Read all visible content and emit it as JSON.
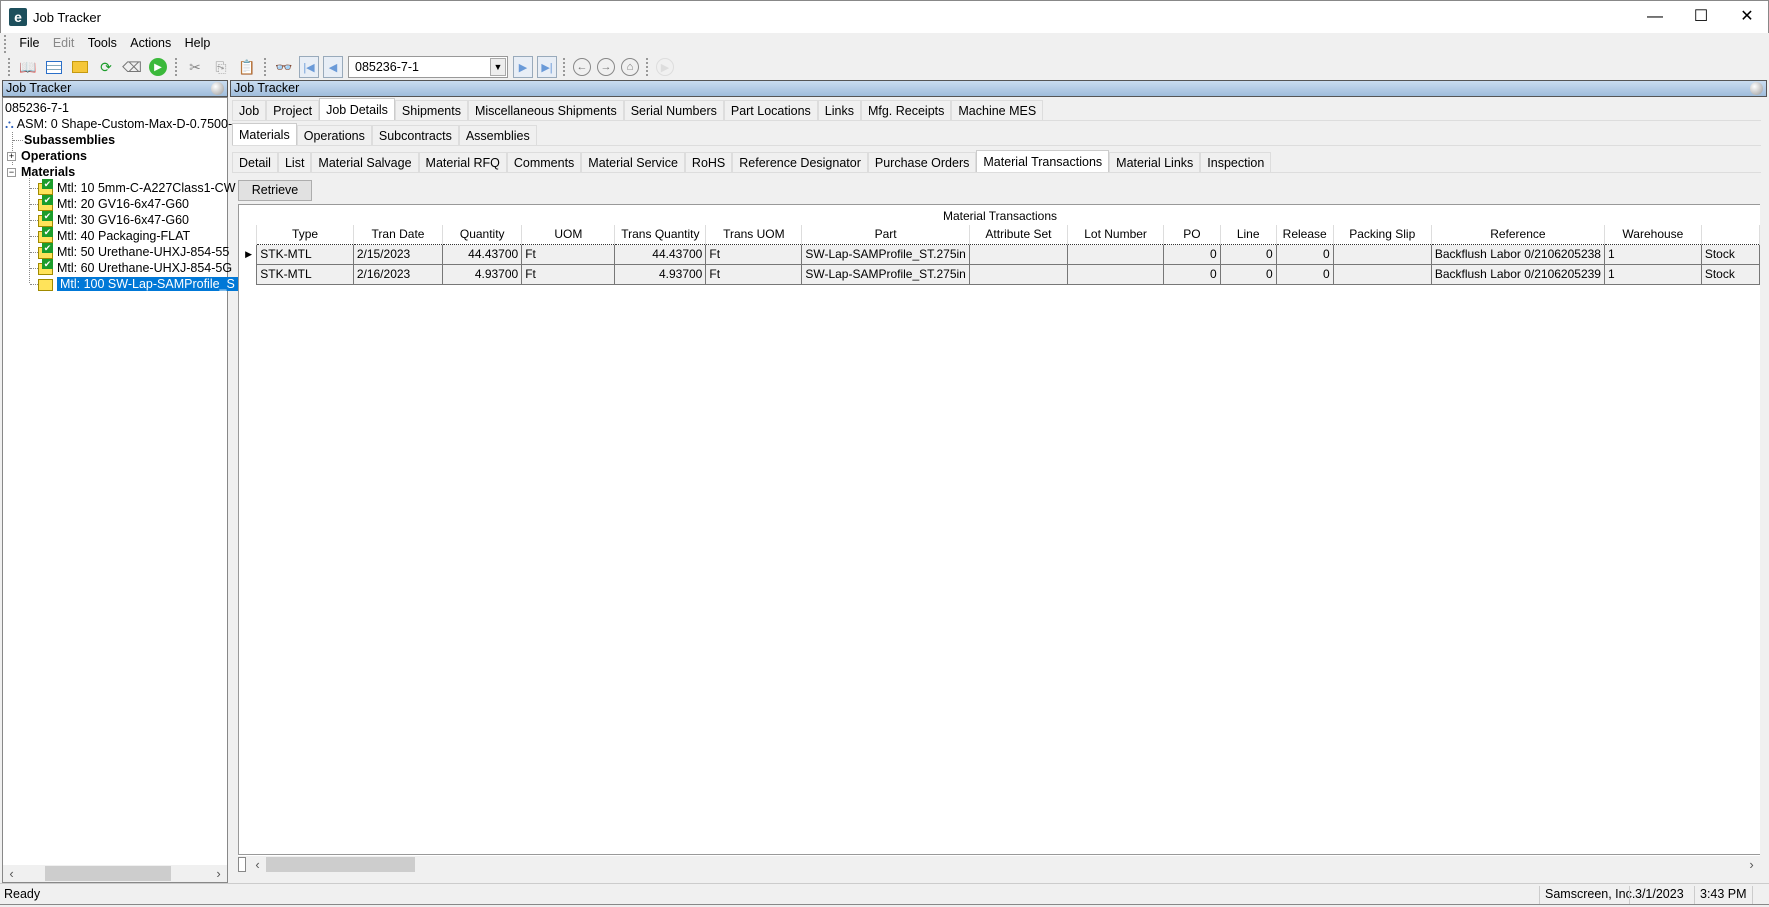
{
  "window": {
    "title": "Job Tracker",
    "minimize": "—",
    "maximize": "☐",
    "close": "✕"
  },
  "menu": [
    "File",
    "Edit",
    "Tools",
    "Actions",
    "Help"
  ],
  "toolbar": {
    "job_number": "085236-7-1"
  },
  "left_pane": {
    "header": "Job Tracker",
    "tree": {
      "root": "085236-7-1",
      "asm": "ASM: 0 Shape-Custom-Max-D-0.7500-",
      "subassemblies": "Subassemblies",
      "operations": "Operations",
      "materials": "Materials",
      "items": [
        {
          "label": "Mtl: 10 5mm-C-A227Class1-CW",
          "checked": true
        },
        {
          "label": "Mtl: 20 GV16-6x47-G60",
          "checked": true
        },
        {
          "label": "Mtl: 30 GV16-6x47-G60",
          "checked": true
        },
        {
          "label": "Mtl: 40 Packaging-FLAT",
          "checked": true
        },
        {
          "label": "Mtl: 50 Urethane-UHXJ-854-55",
          "checked": true
        },
        {
          "label": "Mtl: 60 Urethane-UHXJ-854-5G",
          "checked": true
        },
        {
          "label": "Mtl: 100 SW-Lap-SAMProfile_S",
          "checked": false,
          "selected": true
        }
      ]
    }
  },
  "right_pane": {
    "header": "Job Tracker",
    "tabs1": [
      "Job",
      "Project",
      "Job Details",
      "Shipments",
      "Miscellaneous Shipments",
      "Serial Numbers",
      "Part Locations",
      "Links",
      "Mfg. Receipts",
      "Machine MES"
    ],
    "tabs1_active": "Job Details",
    "tabs2": [
      "Materials",
      "Operations",
      "Subcontracts",
      "Assemblies"
    ],
    "tabs2_active": "Materials",
    "tabs3": [
      "Detail",
      "List",
      "Material Salvage",
      "Material RFQ",
      "Comments",
      "Material Service",
      "RoHS",
      "Reference Designator",
      "Purchase Orders",
      "Material Transactions",
      "Material Links",
      "Inspection"
    ],
    "tabs3_active": "Material Transactions",
    "retrieve_label": "Retrieve",
    "grid": {
      "title": "Material Transactions",
      "columns": [
        "Type",
        "Tran Date",
        "Quantity",
        "UOM",
        "Trans Quantity",
        "Trans UOM",
        "Part",
        "Attribute Set",
        "Lot Number",
        "PO",
        "Line",
        "Release",
        "Packing Slip",
        "Reference",
        "Warehouse",
        ""
      ],
      "rows": [
        [
          "STK-MTL",
          "2/15/2023",
          "44.43700",
          "Ft",
          "44.43700",
          "Ft",
          "SW-Lap-SAMProfile_ST.275in",
          "",
          "",
          "0",
          "0",
          "0",
          "",
          "Backflush Labor 0/2106205238",
          "1",
          "Stock"
        ],
        [
          "STK-MTL",
          "2/16/2023",
          "4.93700",
          "Ft",
          "4.93700",
          "Ft",
          "SW-Lap-SAMProfile_ST.275in",
          "",
          "",
          "0",
          "0",
          "0",
          "",
          "Backflush Labor 0/2106205239",
          "1",
          "Stock"
        ]
      ]
    }
  },
  "status": {
    "text": "Ready",
    "company": "Samscreen, Inc.",
    "date": "3/1/2023",
    "time": "3:43 PM"
  }
}
